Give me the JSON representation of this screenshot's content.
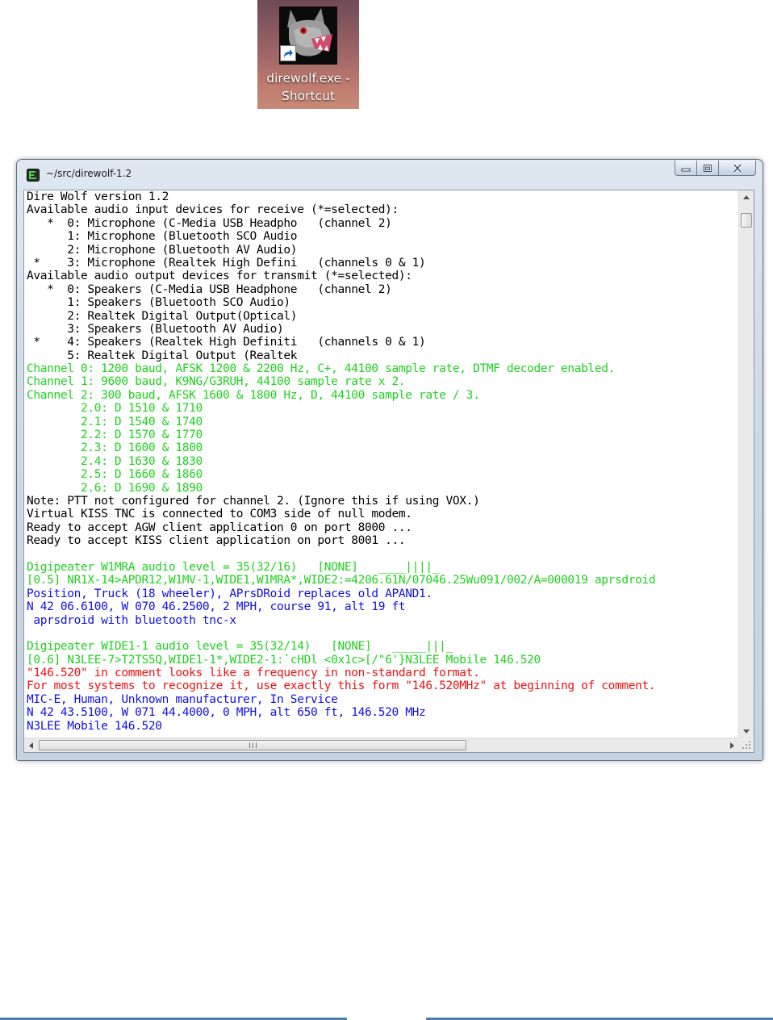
{
  "desktop": {
    "shortcut": {
      "label_line1": "direwolf.exe -",
      "label_line2": "Shortcut",
      "icon": "wolf-head-icon",
      "overlay_icon": "shortcut-arrow-icon"
    }
  },
  "window": {
    "title": "~/src/direwolf-1.2",
    "title_icon": "terminal-icon",
    "controls": [
      "minimize-icon",
      "maximize-icon",
      "close-icon"
    ]
  },
  "colors": {
    "default": "#000000",
    "green": "#1fd11f",
    "blue": "#1010e8",
    "red": "#f01010"
  },
  "console": {
    "lines": [
      {
        "t": "Dire Wolf version 1.2",
        "c": "black"
      },
      {
        "t": "Available audio input devices for receive (*=selected):",
        "c": "black"
      },
      {
        "t": "   *  0: Microphone (C-Media USB Headpho   (channel 2)",
        "c": "black"
      },
      {
        "t": "      1: Microphone (Bluetooth SCO Audio",
        "c": "black"
      },
      {
        "t": "      2: Microphone (Bluetooth AV Audio)",
        "c": "black"
      },
      {
        "t": " *    3: Microphone (Realtek High Defini   (channels 0 & 1)",
        "c": "black"
      },
      {
        "t": "Available audio output devices for transmit (*=selected):",
        "c": "black"
      },
      {
        "t": "   *  0: Speakers (C-Media USB Headphone   (channel 2)",
        "c": "black"
      },
      {
        "t": "      1: Speakers (Bluetooth SCO Audio)",
        "c": "black"
      },
      {
        "t": "      2: Realtek Digital Output(Optical)",
        "c": "black"
      },
      {
        "t": "      3: Speakers (Bluetooth AV Audio)",
        "c": "black"
      },
      {
        "t": " *    4: Speakers (Realtek High Definiti   (channels 0 & 1)",
        "c": "black"
      },
      {
        "t": "      5: Realtek Digital Output (Realtek",
        "c": "black"
      },
      {
        "t": "Channel 0: 1200 baud, AFSK 1200 & 2200 Hz, C+, 44100 sample rate, DTMF decoder enabled.",
        "c": "green"
      },
      {
        "t": "Channel 1: 9600 baud, K9NG/G3RUH, 44100 sample rate x 2.",
        "c": "green"
      },
      {
        "t": "Channel 2: 300 baud, AFSK 1600 & 1800 Hz, D, 44100 sample rate / 3.",
        "c": "green"
      },
      {
        "t": "        2.0: D 1510 & 1710",
        "c": "green"
      },
      {
        "t": "        2.1: D 1540 & 1740",
        "c": "green"
      },
      {
        "t": "        2.2: D 1570 & 1770",
        "c": "green"
      },
      {
        "t": "        2.3: D 1600 & 1800",
        "c": "green"
      },
      {
        "t": "        2.4: D 1630 & 1830",
        "c": "green"
      },
      {
        "t": "        2.5: D 1660 & 1860",
        "c": "green"
      },
      {
        "t": "        2.6: D 1690 & 1890",
        "c": "green"
      },
      {
        "t": "Note: PTT not configured for channel 2. (Ignore this if using VOX.)",
        "c": "black"
      },
      {
        "t": "Virtual KISS TNC is connected to COM3 side of null modem.",
        "c": "black"
      },
      {
        "t": "Ready to accept AGW client application 0 on port 8000 ...",
        "c": "black"
      },
      {
        "t": "Ready to accept KISS client application on port 8001 ...",
        "c": "black"
      },
      {
        "t": "",
        "c": "black"
      },
      {
        "t": "Digipeater W1MRA audio level = 35(32/16)   [NONE]   ____||||_",
        "c": "green"
      },
      {
        "t": "[0.5] NR1X-14>APDR12,W1MV-1,WIDE1,W1MRA*,WIDE2:=4206.61N/07046.25Wu091/002/A=000019 aprsdroid",
        "c": "green"
      },
      {
        "t": "Position, Truck (18 wheeler), APrsDRoid replaces old APAND1.",
        "c": "blue"
      },
      {
        "t": "N 42 06.6100, W 070 46.2500, 2 MPH, course 91, alt 19 ft",
        "c": "blue"
      },
      {
        "t": " aprsdroid with bluetooth tnc-x",
        "c": "blue"
      },
      {
        "t": "",
        "c": "black"
      },
      {
        "t": "Digipeater WIDE1-1 audio level = 35(32/14)   [NONE]   _____|||_",
        "c": "green"
      },
      {
        "t": "[0.6] N3LEE-7>T2TS5Q,WIDE1-1*,WIDE2-1:`cHDl <0x1c>[/\"6'}N3LEE Mobile 146.520",
        "c": "green"
      },
      {
        "t": "\"146.520\" in comment looks like a frequency in non-standard format.",
        "c": "red"
      },
      {
        "t": "For most systems to recognize it, use exactly this form \"146.520MHz\" at beginning of comment.",
        "c": "red"
      },
      {
        "t": "MIC-E, Human, Unknown manufacturer, In Service",
        "c": "blue"
      },
      {
        "t": "N 42 43.5100, W 071 44.4000, 0 MPH, alt 650 ft, 146.520 MHz",
        "c": "blue"
      },
      {
        "t": "N3LEE Mobile 146.520",
        "c": "blue"
      }
    ]
  },
  "scrollbars": {
    "vertical_position": 0.05,
    "horizontal_position": 0.0
  }
}
